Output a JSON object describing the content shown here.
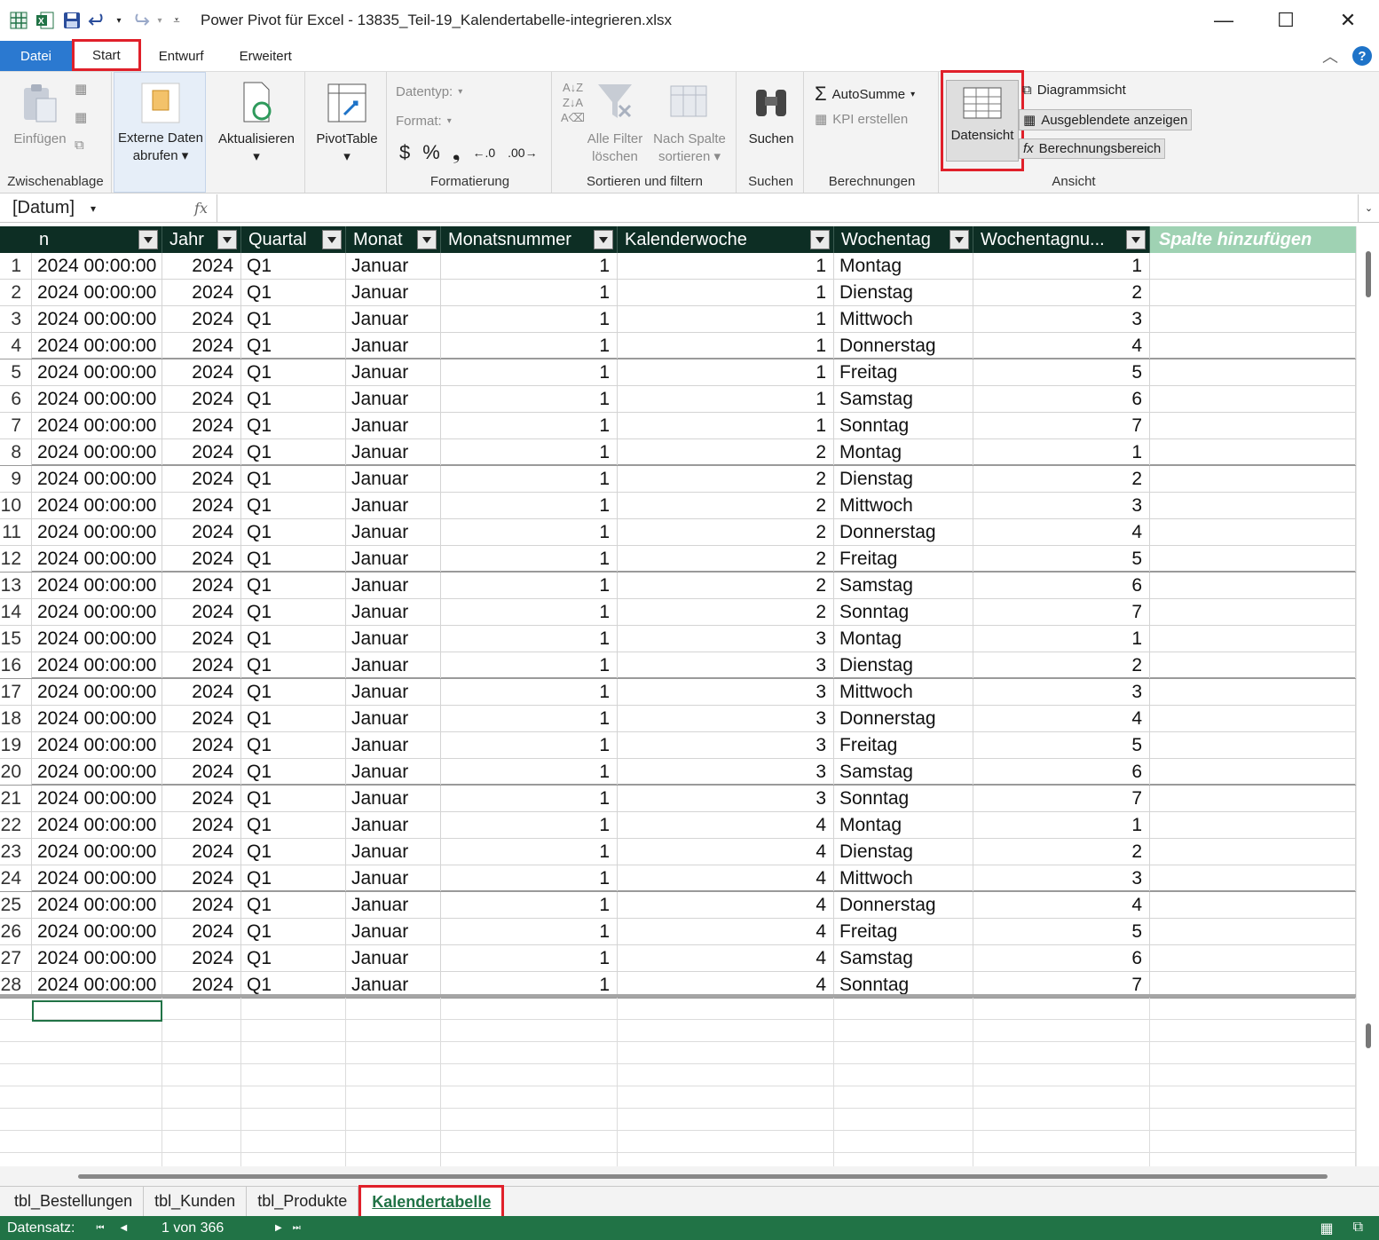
{
  "window": {
    "title": "Power Pivot für Excel - 13835_Teil-19_Kalendertabelle-integrieren.xlsx",
    "minimize": "—",
    "maximize": "☐",
    "close": "✕"
  },
  "tabs": [
    "Datei",
    "Start",
    "Entwurf",
    "Erweitert"
  ],
  "ribbon": {
    "clipboard": {
      "paste": "Einfügen",
      "label": "Zwischenablage"
    },
    "external": {
      "line1": "Externe Daten",
      "line2": "abrufen"
    },
    "refresh": {
      "label": "Aktualisieren"
    },
    "pivot": {
      "label": "PivotTable"
    },
    "format": {
      "datatype": "Datentyp:",
      "format": "Format:",
      "currency": "$",
      "percent": "%",
      "comma": "❟",
      "inc": "←.0",
      "dec": ".00→",
      "label": "Formatierung"
    },
    "sort": {
      "clear1": "Alle Filter",
      "clear2": "löschen",
      "bycol1": "Nach Spalte",
      "bycol2": "sortieren",
      "label": "Sortieren und filtern"
    },
    "find": {
      "btn": "Suchen",
      "label": "Suchen"
    },
    "calc": {
      "autosum": "AutoSumme",
      "kpi": "KPI erstellen",
      "label": "Berechnungen"
    },
    "view": {
      "datasheet": "Datensicht",
      "diagram": "Diagrammsicht",
      "hidden": "Ausgeblendete anzeigen",
      "calcarea": "Berechnungsbereich",
      "label": "Ansicht"
    }
  },
  "formula": {
    "namebox": "[Datum]",
    "fx": "fx"
  },
  "columns": [
    "n",
    "Jahr",
    "Quartal",
    "Monat",
    "Monatsnummer",
    "Kalenderwoche",
    "Wochentag",
    "Wochentagnu...",
    "Spalte hinzufügen"
  ],
  "rows": [
    [
      "1",
      "2024 00:00:00",
      "2024",
      "Q1",
      "Januar",
      "1",
      "1",
      "Montag",
      "1"
    ],
    [
      "2",
      "2024 00:00:00",
      "2024",
      "Q1",
      "Januar",
      "1",
      "1",
      "Dienstag",
      "2"
    ],
    [
      "3",
      "2024 00:00:00",
      "2024",
      "Q1",
      "Januar",
      "1",
      "1",
      "Mittwoch",
      "3"
    ],
    [
      "4",
      "2024 00:00:00",
      "2024",
      "Q1",
      "Januar",
      "1",
      "1",
      "Donnerstag",
      "4"
    ],
    [
      "5",
      "2024 00:00:00",
      "2024",
      "Q1",
      "Januar",
      "1",
      "1",
      "Freitag",
      "5"
    ],
    [
      "6",
      "2024 00:00:00",
      "2024",
      "Q1",
      "Januar",
      "1",
      "1",
      "Samstag",
      "6"
    ],
    [
      "7",
      "2024 00:00:00",
      "2024",
      "Q1",
      "Januar",
      "1",
      "1",
      "Sonntag",
      "7"
    ],
    [
      "8",
      "2024 00:00:00",
      "2024",
      "Q1",
      "Januar",
      "1",
      "2",
      "Montag",
      "1"
    ],
    [
      "9",
      "2024 00:00:00",
      "2024",
      "Q1",
      "Januar",
      "1",
      "2",
      "Dienstag",
      "2"
    ],
    [
      "10",
      "2024 00:00:00",
      "2024",
      "Q1",
      "Januar",
      "1",
      "2",
      "Mittwoch",
      "3"
    ],
    [
      "11",
      "2024 00:00:00",
      "2024",
      "Q1",
      "Januar",
      "1",
      "2",
      "Donnerstag",
      "4"
    ],
    [
      "12",
      "2024 00:00:00",
      "2024",
      "Q1",
      "Januar",
      "1",
      "2",
      "Freitag",
      "5"
    ],
    [
      "13",
      "2024 00:00:00",
      "2024",
      "Q1",
      "Januar",
      "1",
      "2",
      "Samstag",
      "6"
    ],
    [
      "14",
      "2024 00:00:00",
      "2024",
      "Q1",
      "Januar",
      "1",
      "2",
      "Sonntag",
      "7"
    ],
    [
      "15",
      "2024 00:00:00",
      "2024",
      "Q1",
      "Januar",
      "1",
      "3",
      "Montag",
      "1"
    ],
    [
      "16",
      "2024 00:00:00",
      "2024",
      "Q1",
      "Januar",
      "1",
      "3",
      "Dienstag",
      "2"
    ],
    [
      "17",
      "2024 00:00:00",
      "2024",
      "Q1",
      "Januar",
      "1",
      "3",
      "Mittwoch",
      "3"
    ],
    [
      "18",
      "2024 00:00:00",
      "2024",
      "Q1",
      "Januar",
      "1",
      "3",
      "Donnerstag",
      "4"
    ],
    [
      "19",
      "2024 00:00:00",
      "2024",
      "Q1",
      "Januar",
      "1",
      "3",
      "Freitag",
      "5"
    ],
    [
      "20",
      "2024 00:00:00",
      "2024",
      "Q1",
      "Januar",
      "1",
      "3",
      "Samstag",
      "6"
    ],
    [
      "21",
      "2024 00:00:00",
      "2024",
      "Q1",
      "Januar",
      "1",
      "3",
      "Sonntag",
      "7"
    ],
    [
      "22",
      "2024 00:00:00",
      "2024",
      "Q1",
      "Januar",
      "1",
      "4",
      "Montag",
      "1"
    ],
    [
      "23",
      "2024 00:00:00",
      "2024",
      "Q1",
      "Januar",
      "1",
      "4",
      "Dienstag",
      "2"
    ],
    [
      "24",
      "2024 00:00:00",
      "2024",
      "Q1",
      "Januar",
      "1",
      "4",
      "Mittwoch",
      "3"
    ],
    [
      "25",
      "2024 00:00:00",
      "2024",
      "Q1",
      "Januar",
      "1",
      "4",
      "Donnerstag",
      "4"
    ],
    [
      "26",
      "2024 00:00:00",
      "2024",
      "Q1",
      "Januar",
      "1",
      "4",
      "Freitag",
      "5"
    ],
    [
      "27",
      "2024 00:00:00",
      "2024",
      "Q1",
      "Januar",
      "1",
      "4",
      "Samstag",
      "6"
    ],
    [
      "28",
      "2024 00:00:00",
      "2024",
      "Q1",
      "Januar",
      "1",
      "4",
      "Sonntag",
      "7"
    ]
  ],
  "sheets": [
    "tbl_Bestellungen",
    "tbl_Kunden",
    "tbl_Produkte",
    "Kalendertabelle"
  ],
  "status": {
    "label": "Datensatz:",
    "record": "1 von 366"
  },
  "colors": {
    "header": "#0d2e24",
    "accent": "#217346",
    "highlight": "#e0202a",
    "file_tab": "#2b79d0"
  }
}
